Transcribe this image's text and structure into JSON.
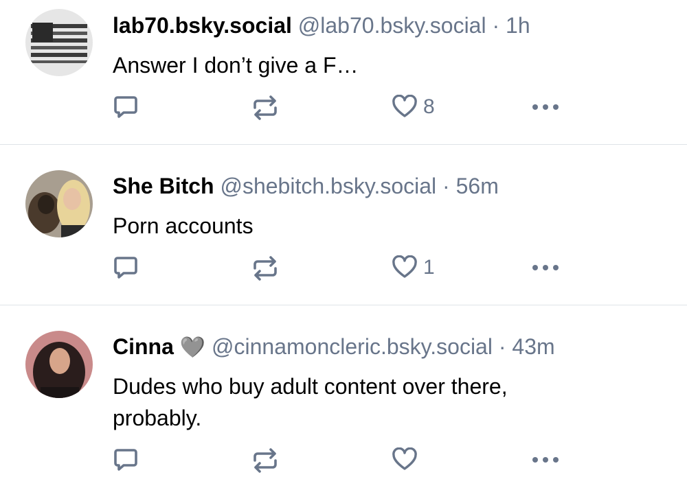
{
  "posts": [
    {
      "display_name": "lab70.bsky.social",
      "handle": "@lab70.bsky.social",
      "separator": "·",
      "time": "1h",
      "text": "Answer I don’t give a F…",
      "like_count": "8",
      "avatar": "flag-avatar"
    },
    {
      "display_name": "She Bitch",
      "handle": "@shebitch.bsky.social",
      "separator": "·",
      "time": "56m",
      "text": "Porn accounts",
      "like_count": "1",
      "avatar": "woman-with-dog-avatar"
    },
    {
      "display_name": "Cinna",
      "badge": "🩶",
      "handle": "@cinnamoncleric.bsky.social",
      "separator": "·",
      "time": "43m",
      "text_line1": "Dudes who buy adult content over there,",
      "text_line2": "probably.",
      "like_count": "",
      "avatar": "woman-portrait-avatar"
    }
  ],
  "icons": {
    "reply": "reply-icon",
    "repost": "repost-icon",
    "like": "heart-icon",
    "more": "more-options-icon"
  },
  "colors": {
    "meta_text": "#68758a",
    "divider": "#dfe3e8"
  }
}
